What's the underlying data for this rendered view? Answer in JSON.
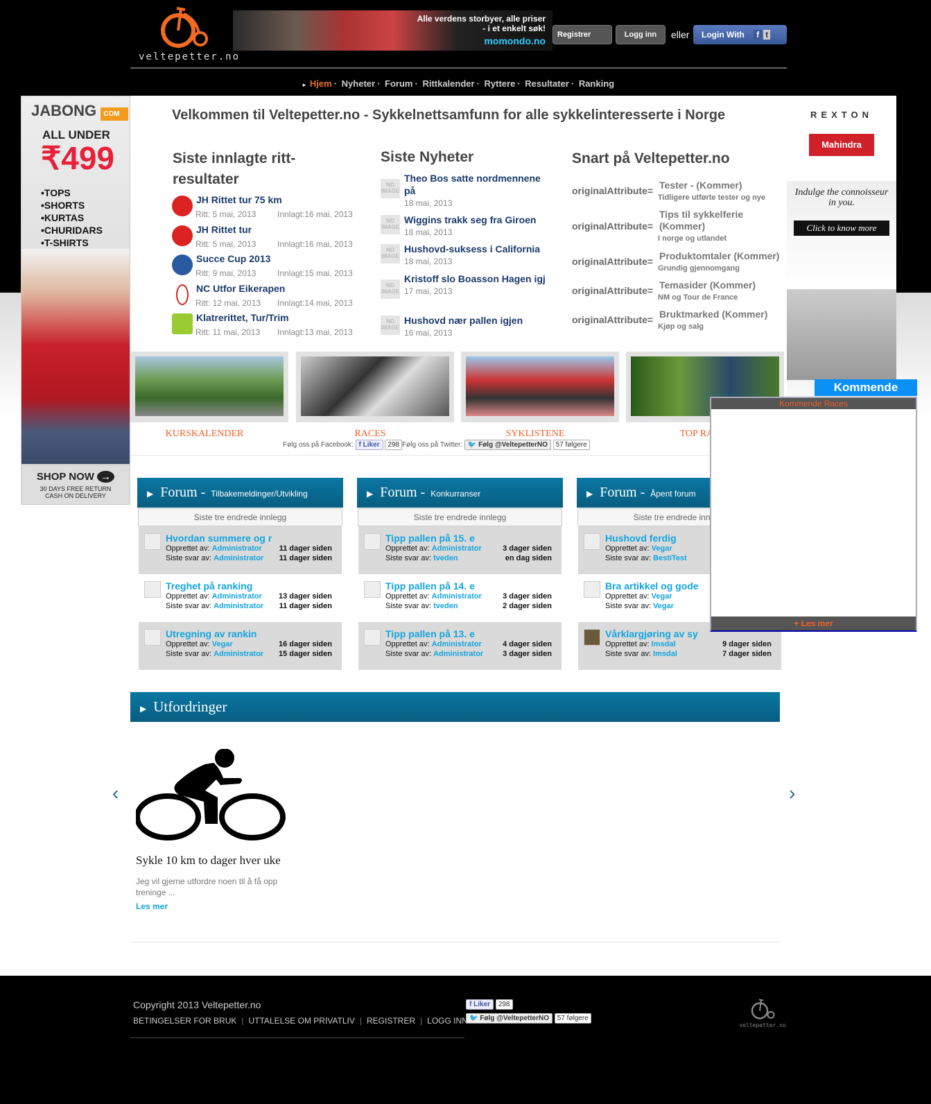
{
  "header": {
    "logo_text": "veltepetter.no",
    "banner": {
      "line1": "Alle verdens storbyer, alle priser",
      "line2": "- i et enkelt søk!",
      "brand": "momondo.no"
    },
    "register": "Registrer",
    "login": "Logg inn",
    "or": "eller",
    "login_with": "Login With"
  },
  "nav": [
    "Hjem",
    "Nyheter",
    "Forum",
    "Rittkalender",
    "Ryttere",
    "Resultater",
    "Ranking"
  ],
  "left_ad": {
    "brand": "JABONG",
    "com": "COM",
    "headline": "ALL UNDER",
    "price": "₹499",
    "items": [
      "•TOPS",
      "•SHORTS",
      "•KURTAS",
      "•CHURIDARS",
      "•T-SHIRTS"
    ],
    "cta": "SHOP NOW",
    "foot1": "30 DAYS FREE RETURN",
    "foot2": "CASH ON DELIVERY"
  },
  "right_ad": {
    "brand": "REXTON",
    "maker": "Mahindra",
    "tagline": "Indulge the connoisseur in you.",
    "cta": "Click to know more"
  },
  "title": "Velkommen til Veltepetter.no - Sykkelnettsamfunn for alle sykkelinteresserte i Norge",
  "results": {
    "heading": "Siste innlagte ritt-resultater",
    "items": [
      {
        "title": "JH Rittet tur 75 km",
        "race": "Ritt: 5 mai, 2013",
        "added": "Innlagt:16 mai, 2013"
      },
      {
        "title": "JH Rittet tur",
        "race": "Ritt: 5 mai, 2013",
        "added": "Innlagt:16 mai, 2013"
      },
      {
        "title": "Succe Cup 2013",
        "race": "Ritt: 9 mai, 2013",
        "added": "Innlagt:15 mai, 2013"
      },
      {
        "title": "NC Utfor Eikerapen",
        "race": "Ritt: 12 mai, 2013",
        "added": "Innlagt:14 mai, 2013"
      },
      {
        "title": "Klatrerittet, Tur/Trim",
        "race": "Ritt: 11 mai, 2013",
        "added": "Innlagt:13 mai, 2013"
      }
    ]
  },
  "news": {
    "heading": "Siste Nyheter",
    "noimage": "NO IMAGE",
    "items": [
      {
        "title": "Theo Bos satte nordmennene på",
        "date": "18 mai, 2013"
      },
      {
        "title": "Wiggins trakk seg fra Giroen",
        "date": "18 mai, 2013"
      },
      {
        "title": "Hushovd-suksess i California",
        "date": "18 mai, 2013"
      },
      {
        "title": "Kristoff slo Boasson Hagen igj",
        "date": "17 mai, 2013"
      },
      {
        "title": "Hushovd nær pallen igjen",
        "date": "16 mai, 2013"
      }
    ]
  },
  "soon": {
    "heading": "Snart på Veltepetter.no",
    "key": "originalAttribute=",
    "items": [
      {
        "title": "Tester - (Kommer)",
        "sub": "Tidligere utførte tester og nye"
      },
      {
        "title": "Tips til sykkelferie (Kommer)",
        "sub": "I norge og utlandet"
      },
      {
        "title": "Produktomtaler (Kommer)",
        "sub": "Grundig gjennomgang"
      },
      {
        "title": "Temasider (Kommer)",
        "sub": "NM og Tour de France"
      },
      {
        "title": "Bruktmarked (Kommer)",
        "sub": "Kjøp og salg"
      }
    ]
  },
  "tiles": [
    "KURSKALENDER",
    "RACES",
    "SYKLISTENE",
    "TOP RAN"
  ],
  "social": {
    "fb_label": "Følg oss på Facebook:",
    "like": "Liker",
    "like_count": "298",
    "tw_label": "Følg oss på Twitter:",
    "follow": "Følg @VeltepetterNO",
    "followers": "57 følgere"
  },
  "forums": [
    {
      "title": "Forum -",
      "sub": "Tilbakemeldinger/Utvikling",
      "caption": "Siste tre endrede innlegg",
      "rows": [
        {
          "t": "Hvordan summere og r",
          "by": "Administrator",
          "last": "Administrator",
          "c": "11 dager siden",
          "r": "11 dager siden"
        },
        {
          "t": "Treghet på ranking",
          "by": "Administrator",
          "last": "Administrator",
          "c": "13 dager siden",
          "r": "11 dager siden"
        },
        {
          "t": "Utregning av rankin",
          "by": "Vegar",
          "last": "Administrator",
          "c": "16 dager siden",
          "r": "15 dager siden"
        }
      ]
    },
    {
      "title": "Forum -",
      "sub": "Konkurranser",
      "caption": "Siste tre endrede innlegg",
      "rows": [
        {
          "t": "Tipp pallen på 15. e",
          "by": "Administrator",
          "last": "tveden",
          "c": "3 dager siden",
          "r": "en dag siden"
        },
        {
          "t": "Tipp pallen på 14. e",
          "by": "Administrator",
          "last": "tveden",
          "c": "3 dager siden",
          "r": "2 dager siden"
        },
        {
          "t": "Tipp pallen på 13. e",
          "by": "Administrator",
          "last": "Administrator",
          "c": "4 dager siden",
          "r": "3 dager siden"
        }
      ]
    },
    {
      "title": "Forum -",
      "sub": "Åpent forum",
      "caption": "Siste tre endrede innlegg",
      "rows": [
        {
          "t": "Hushovd ferdig",
          "by": "Vegar",
          "last": "BestiTest"
        },
        {
          "t": "Bra artikkel og gode",
          "by": "Vegar",
          "last": "Vegar"
        },
        {
          "t": "Vårklargjøring av sy",
          "by": "Imsdal",
          "last": "Imsdal",
          "c": "9 dager siden",
          "r": "7 dager siden"
        }
      ]
    }
  ],
  "forum_labels": {
    "created": "Opprettet av: ",
    "last": "Siste svar av: "
  },
  "challenges": {
    "heading": "Utfordringer",
    "prev": "‹",
    "next": "›",
    "card": {
      "title": "Sykle 10 km to dager hver uke",
      "desc": "Jeg vil gjerne utfordre noen til å få opp treninge ...",
      "more": "Les mer"
    }
  },
  "popup": {
    "tab": "Kommende",
    "header": "Kommende Races",
    "more": "+ Les mer"
  },
  "footer": {
    "copyright": "Copyright 2013 Veltepetter.no",
    "links": [
      "BETINGELSER FOR BRUK",
      "UTTALELSE OM PRIVATLIV",
      "REGISTRER",
      "LOGG INN"
    ],
    "logo_text": "veltepetter.no"
  },
  "colors": {
    "accent": "#e8702a",
    "link": "#13a4e0",
    "header_blue": "#0a77a3",
    "title_navy": "#1a3a6a"
  }
}
